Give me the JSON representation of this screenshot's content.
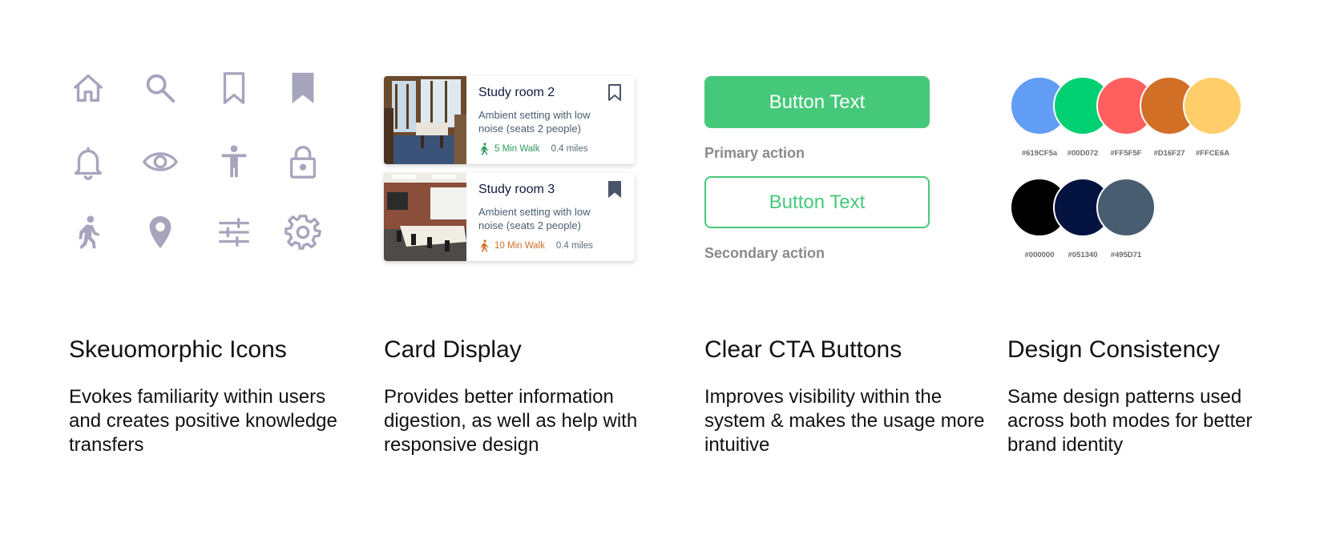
{
  "colors": {
    "icon": "#a7a5bd",
    "accent_green": "#46C87A",
    "walk_green": "#2e9a5a",
    "walk_orange": "#D16F27",
    "title_navy": "#0d1b3e",
    "desc_slate": "#495D71"
  },
  "icons": [
    {
      "name": "home-icon"
    },
    {
      "name": "search-icon"
    },
    {
      "name": "bookmark-outline-icon"
    },
    {
      "name": "bookmark-filled-icon"
    },
    {
      "name": "bell-icon"
    },
    {
      "name": "eye-icon"
    },
    {
      "name": "accessibility-icon"
    },
    {
      "name": "lock-icon"
    },
    {
      "name": "walking-person-icon"
    },
    {
      "name": "map-pin-icon"
    },
    {
      "name": "sliders-icon"
    },
    {
      "name": "gear-icon"
    }
  ],
  "cards": [
    {
      "title": "Study room 2",
      "description": "Ambient setting with low noise (seats 2 people)",
      "walk": "5 Min Walk",
      "distance": "0.4 miles",
      "bookmarked": false
    },
    {
      "title": "Study room 3",
      "description": "Ambient setting with low noise (seats 2 people)",
      "walk": "10 Min Walk",
      "distance": "0.4 miles",
      "bookmarked": true
    }
  ],
  "buttons": {
    "primary_label": "Button Text",
    "primary_caption": "Primary action",
    "secondary_label": "Button Text",
    "secondary_caption": "Secondary action"
  },
  "swatches": {
    "row1": [
      {
        "hex": "#619CF5",
        "label": "#619CF5a"
      },
      {
        "hex": "#00D072",
        "label": "#00D072"
      },
      {
        "hex": "#FF5F5F",
        "label": "#FF5F5F"
      },
      {
        "hex": "#D16F27",
        "label": "#D16F27"
      },
      {
        "hex": "#FFCE6A",
        "label": "#FFCE6A"
      }
    ],
    "row2": [
      {
        "hex": "#000000",
        "label": "#000000"
      },
      {
        "hex": "#051340",
        "label": "#051340"
      },
      {
        "hex": "#495D71",
        "label": "#495D71"
      }
    ]
  },
  "features": [
    {
      "title": "Skeuomorphic Icons",
      "description": "Evokes familiarity within users and creates positive knowledge transfers"
    },
    {
      "title": "Card Display",
      "description": "Provides better information digestion, as well as help with responsive design"
    },
    {
      "title": "Clear CTA Buttons",
      "description": "Improves visibility within the system & makes the usage more intuitive"
    },
    {
      "title": "Design Consistency",
      "description": "Same design patterns used across both modes for better brand identity"
    }
  ]
}
